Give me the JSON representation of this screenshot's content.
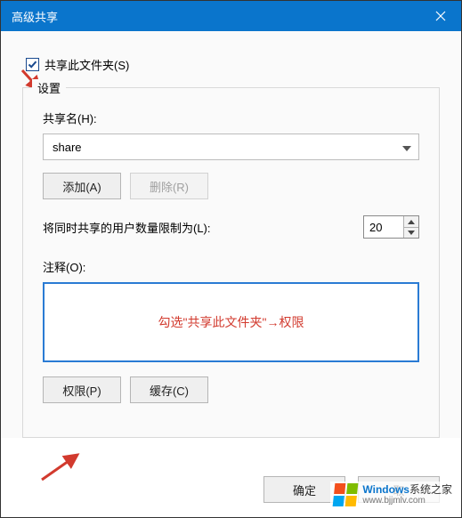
{
  "title": "高级共享",
  "share_checkbox_label": "共享此文件夹(S)",
  "group": {
    "label": "设置",
    "share_name_label": "共享名(H):",
    "share_name_value": "share",
    "add_label": "添加(A)",
    "delete_label": "删除(R)",
    "limit_label": "将同时共享的用户数量限制为(L):",
    "limit_value": "20",
    "comment_label": "注释(O):",
    "comment_hint": "勾选\"共享此文件夹\"→权限",
    "perm_label": "权限(P)",
    "cache_label": "缓存(C)"
  },
  "footer": {
    "ok": "确定",
    "cancel": "取"
  },
  "watermark": {
    "brand": "Windows",
    "suffix": "系统之家",
    "url": "www.bjjmlv.com"
  }
}
